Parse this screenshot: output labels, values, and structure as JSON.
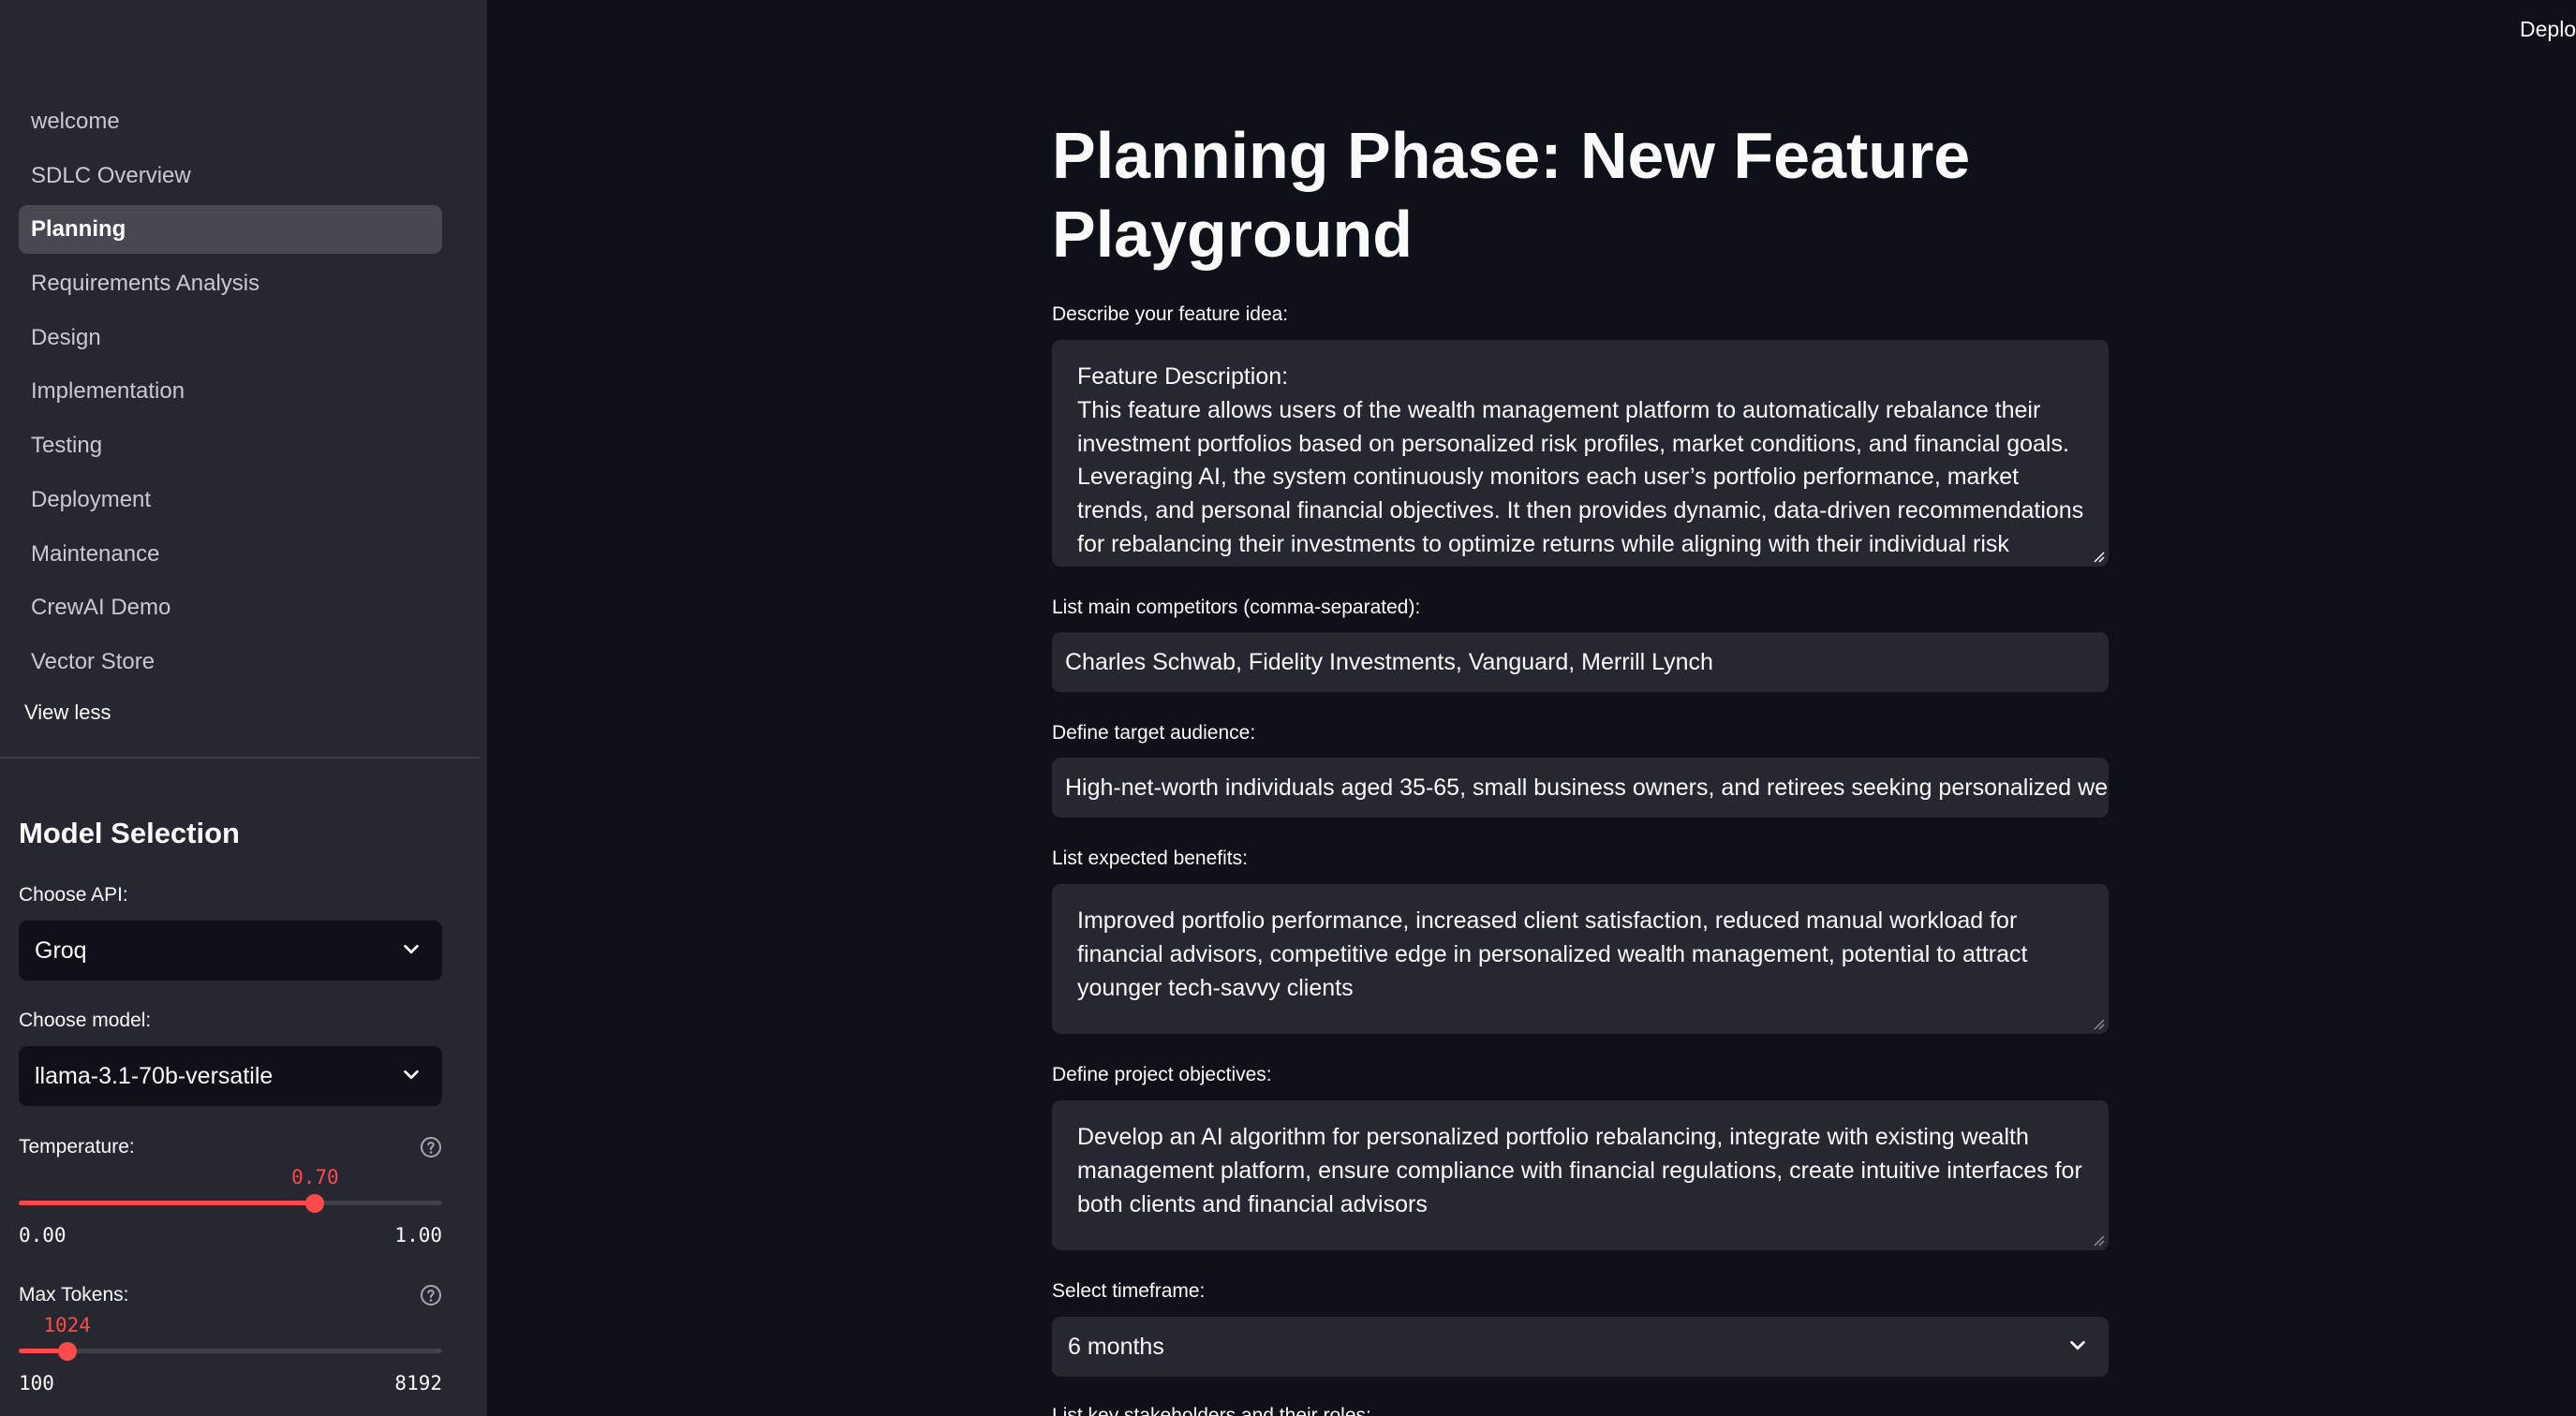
{
  "header": {
    "deploy_label": "Deploy"
  },
  "sidebar": {
    "nav_items": [
      {
        "label": "welcome",
        "active": false
      },
      {
        "label": "SDLC Overview",
        "active": false
      },
      {
        "label": "Planning",
        "active": true
      },
      {
        "label": "Requirements Analysis",
        "active": false
      },
      {
        "label": "Design",
        "active": false
      },
      {
        "label": "Implementation",
        "active": false
      },
      {
        "label": "Testing",
        "active": false
      },
      {
        "label": "Deployment",
        "active": false
      },
      {
        "label": "Maintenance",
        "active": false
      },
      {
        "label": "CrewAI Demo",
        "active": false
      },
      {
        "label": "Vector Store",
        "active": false
      }
    ],
    "view_less_label": "View less",
    "model_selection": {
      "heading": "Model Selection",
      "api": {
        "label": "Choose API:",
        "value": "Groq"
      },
      "model": {
        "label": "Choose model:",
        "value": "llama-3.1-70b-versatile"
      },
      "temperature": {
        "label": "Temperature:",
        "value": "0.70",
        "min": "0.00",
        "max": "1.00",
        "fraction": 0.7
      },
      "max_tokens": {
        "label": "Max Tokens:",
        "value": "1024",
        "min": "100",
        "max": "8192",
        "fraction": 0.1143
      }
    }
  },
  "main": {
    "title": "Planning Phase: New Feature Playground",
    "feature_idea": {
      "label": "Describe your feature idea:",
      "value": "Feature Description:\nThis feature allows users of the wealth management platform to automatically rebalance their investment portfolios based on personalized risk profiles, market conditions, and financial goals. Leveraging AI, the system continuously monitors each user’s portfolio performance, market trends, and personal financial objectives. It then provides dynamic, data-driven recommendations for rebalancing their investments to optimize returns while aligning with their individual risk tolerance."
    },
    "competitors": {
      "label": "List main competitors (comma-separated):",
      "value": "Charles Schwab, Fidelity Investments, Vanguard, Merrill Lynch"
    },
    "target_audience": {
      "label": "Define target audience:",
      "value": "High-net-worth individuals aged 35-65, small business owners, and retirees seeking personalized wealth management"
    },
    "benefits": {
      "label": "List expected benefits:",
      "value": "Improved portfolio performance, increased client satisfaction, reduced manual workload for financial advisors, competitive edge in personalized wealth management, potential to attract younger tech-savvy clients"
    },
    "objectives": {
      "label": "Define project objectives:",
      "value": "Develop an AI algorithm for personalized portfolio rebalancing, integrate with existing wealth management platform, ensure compliance with financial regulations, create intuitive interfaces for both clients and financial advisors"
    },
    "timeframe": {
      "label": "Select timeframe:",
      "value": "6 months"
    },
    "stakeholders": {
      "label": "List key stakeholders and their roles:"
    }
  },
  "colors": {
    "accent": "#ff4b4b",
    "app_background": "#0e1117",
    "sidebar_background": "#262730",
    "input_background": "#262730"
  }
}
